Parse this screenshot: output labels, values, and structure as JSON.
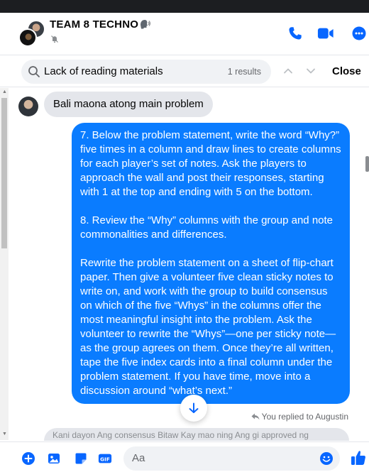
{
  "header": {
    "title": "TEAM 8 TECHNO",
    "title_emoji": "speaking-head-emoji",
    "call_icon": "phone-icon",
    "video_icon": "video-camera-icon",
    "more_icon": "more-icon"
  },
  "search": {
    "query": "Lack of reading materials",
    "result_count": "1 results",
    "close_label": "Close"
  },
  "messages": {
    "incoming": {
      "text": "Bali maona atong main problem"
    },
    "outgoing": {
      "text": "7. Below the problem statement, write the word “Why?” five times in a column and draw lines to create columns for each player’s set of notes. Ask the players to approach the wall and post their responses, starting with 1 at the top and ending with 5 on the bottom.\n\n8. Review the “Why” columns with the group and note commonalities and differences.\n\nRewrite the problem statement on a sheet of flip-chart paper. Then give a volunteer five clean sticky notes to write on, and work with the group to build consensus on which of the five “Whys” in the columns offer the most meaningful insight into the problem. Ask the volunteer to rewrite the “Whys”—one per sticky note—as the group agrees on them.  Once they’re all written, tape the five index cards into a final column under the problem statement. If you have time, move into a discussion around “what’s next.”"
    },
    "reply_note": "You replied to Augustin",
    "partial_text": "Kani dayon Ang consensus Bitaw Kay mao ning Ang gi approved ng"
  },
  "composer": {
    "placeholder": "Aa"
  },
  "colors": {
    "accent": "#0a7cff",
    "icon_blue": "#0866ff",
    "incoming_bubble": "#e4e6eb",
    "field_bg": "#f0f2f5",
    "secondary_text": "#65676b"
  }
}
